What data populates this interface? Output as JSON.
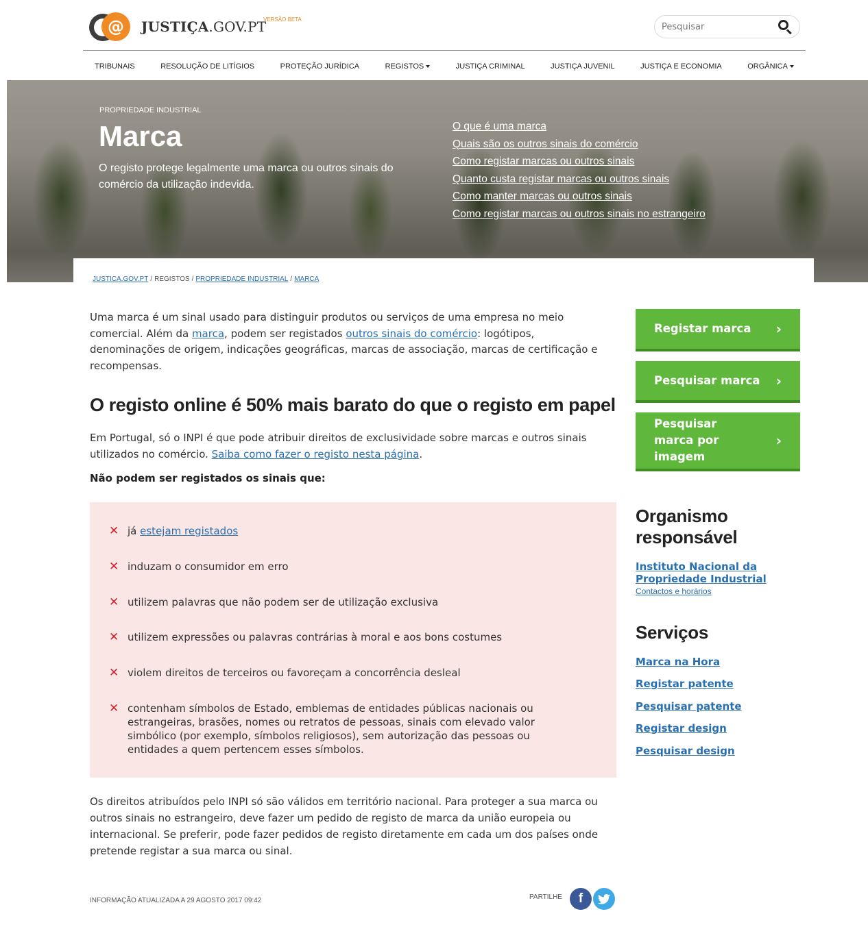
{
  "header": {
    "logo_text_bold": "JUSTIÇA",
    "logo_text_rest": ".GOV.PT",
    "beta_label": "VERSÃO BETA",
    "search_placeholder": "Pesquisar",
    "search_icon": "search-icon"
  },
  "nav": {
    "items": [
      {
        "label": "TRIBUNAIS",
        "dropdown": false
      },
      {
        "label": "RESOLUÇÃO DE LITÍGIOS",
        "dropdown": false
      },
      {
        "label": "PROTEÇÃO JURÍDICA",
        "dropdown": false
      },
      {
        "label": "REGISTOS",
        "dropdown": true
      },
      {
        "label": "JUSTIÇA CRIMINAL",
        "dropdown": false
      },
      {
        "label": "JUSTIÇA JUVENIL",
        "dropdown": false
      },
      {
        "label": "JUSTIÇA E ECONOMIA",
        "dropdown": false
      },
      {
        "label": "ORGÂNICA",
        "dropdown": true
      }
    ]
  },
  "hero": {
    "kicker": "PROPRIEDADE INDUSTRIAL",
    "title": "Marca",
    "description": "O registo protege legalmente uma marca ou outros sinais do comércio da utilização indevida.",
    "links": [
      "O que é uma marca",
      "Quais são os outros sinais do comércio",
      "Como registar marcas ou outros sinais",
      "Quanto custa registar marcas ou outros sinais",
      "Como manter marcas ou outros sinais",
      "Como registar marcas ou outros sinais no estrangeiro"
    ]
  },
  "breadcrumb": {
    "items": [
      "JUSTICA.GOV.PT",
      "REGISTOS",
      "PROPRIEDADE INDUSTRIAL",
      "MARCA"
    ],
    "separator": "/"
  },
  "main": {
    "intro_a": "Uma marca é um sinal usado para distinguir produtos ou serviços de uma empresa no meio comercial. Além da ",
    "intro_link1": "marca",
    "intro_b": ", podem ser registados ",
    "intro_link2": "outros sinais do comércio",
    "intro_c": ": logótipos, denominações de origem, indicações geográficas, marcas de associação, marcas de certificação e recompensas.",
    "heading": "O registo online é 50% mais barato do que o registo em papel",
    "para_a": "Em Portugal, só o INPI é que pode atribuir direitos de exclusividade sobre marcas e outros sinais utilizados no comércio. ",
    "para_link": "Saiba como fazer o registo nesta página",
    "para_b": ".",
    "subheading": "Não podem ser registados os sinais que:",
    "restrictions": [
      {
        "prefix": "já ",
        "link": "estejam registados",
        "text": ""
      },
      {
        "prefix": "",
        "link": "",
        "text": "induzam o consumidor em erro"
      },
      {
        "prefix": "",
        "link": "",
        "text": "utilizem palavras que não podem ser de utilização exclusiva"
      },
      {
        "prefix": "",
        "link": "",
        "text": "utilizem expressões ou palavras contrárias à moral e aos bons costumes"
      },
      {
        "prefix": "",
        "link": "",
        "text": "violem direitos de terceiros ou favoreçam a concorrência desleal"
      },
      {
        "prefix": "",
        "link": "",
        "text": "contenham símbolos de Estado, emblemas de entidades públicas nacionais ou estrangeiras, brasões, nomes ou retratos de pessoas, sinais com elevado valor simbólico (por exemplo, símbolos religiosos), sem autorização das pessoas ou entidades a quem pertencem esses símbolos."
      }
    ],
    "x_mark": "✕",
    "outro": "Os direitos atribuídos pelo INPI só são válidos em território nacional. Para proteger a sua marca ou outros sinais no estrangeiro, deve fazer um pedido de registo de marca da união europeia ou internacional. Se preferir, pode fazer pedidos de registo diretamente em cada um dos países onde pretende registar a sua marca ou sinal.",
    "updated": "INFORMAÇÃO ATUALIZADA A 29 AGOSTO 2017 09:42",
    "share_label": "PARTILHE",
    "facebook_glyph": "f"
  },
  "sidebar": {
    "cta_buttons": [
      "Registar marca",
      "Pesquisar marca",
      "Pesquisar marca por imagem"
    ],
    "cta_chevron": "›",
    "org_heading": "Organismo responsável",
    "org_name": "Instituto Nacional da Propriedade Industrial",
    "org_contacts": "Contactos e horários",
    "services_heading": "Serviços",
    "services": [
      "Marca na Hora",
      "Registar patente",
      "Pesquisar patente",
      "Registar design",
      "Pesquisar design"
    ]
  },
  "colors": {
    "accent_green": "#5fb83c",
    "link_blue": "#2a6fb0",
    "warning_bg": "#fbe6e6",
    "x_red": "#d0202a",
    "logo_orange": "#f08a24"
  }
}
